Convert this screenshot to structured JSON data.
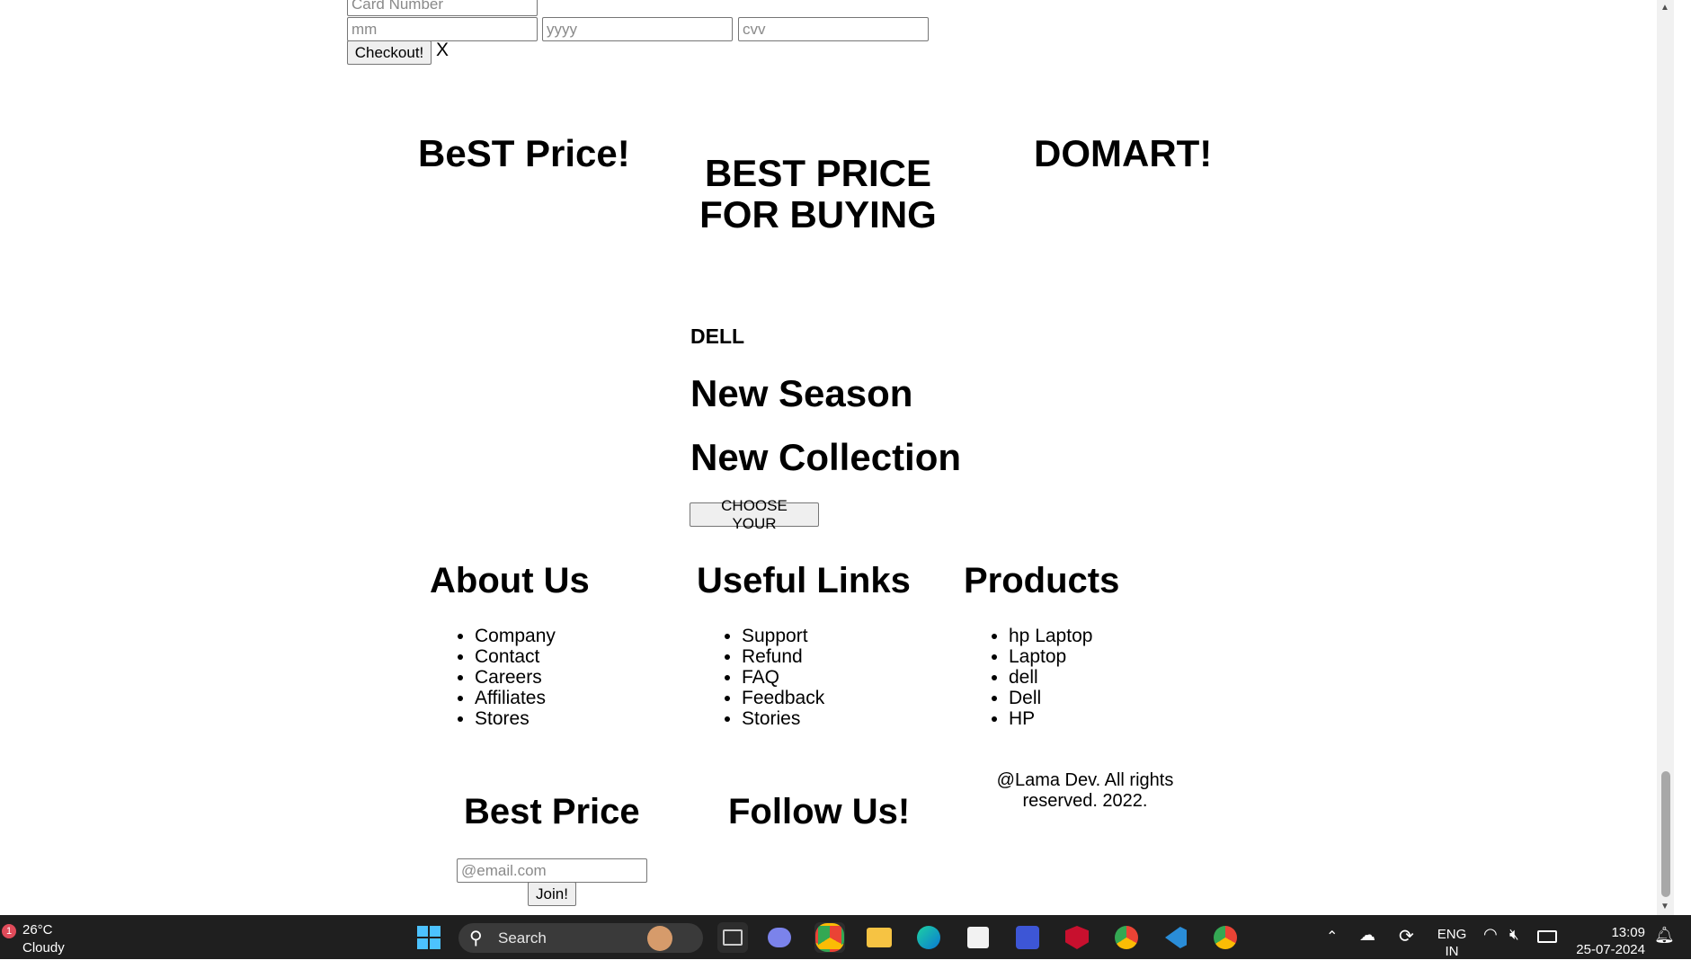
{
  "checkout": {
    "card_number_placeholder": "Card Number",
    "month_placeholder": "mm",
    "year_placeholder": "yyyy",
    "cvv_placeholder": "cvv",
    "checkout_label": "Checkout!",
    "close_label": "X"
  },
  "banner": {
    "left": "BeST Price!",
    "center_line1": "BEST PRICE",
    "center_line2": "FOR BUYING",
    "right": "DOMART!"
  },
  "hero": {
    "brand": "DELL",
    "line1": "New Season",
    "line2": "New Collection",
    "button": "CHOOSE YOUR"
  },
  "footer": {
    "about": {
      "title": "About Us",
      "items": [
        "Company",
        "Contact",
        "Careers",
        "Affiliates",
        "Stores"
      ]
    },
    "useful": {
      "title": "Useful Links",
      "items": [
        "Support",
        "Refund",
        "FAQ",
        "Feedback",
        "Stories"
      ]
    },
    "products": {
      "title": "Products",
      "items": [
        "hp Laptop",
        "Laptop",
        "dell",
        "Dell",
        "HP"
      ]
    },
    "copyright_line1": "@Lama Dev. All rights",
    "copyright_line2": "reserved. 2022.",
    "newsletter": {
      "title": "Best Price",
      "email_placeholder": "@email.com",
      "join_label": "Join!"
    },
    "follow_title": "Follow Us!"
  },
  "taskbar": {
    "weather_temp": "26°C",
    "weather_desc": "Cloudy",
    "weather_badge": "1",
    "search_label": "Search",
    "lang_top": "ENG",
    "lang_bottom": "IN",
    "time": "13:09",
    "date": "25-07-2024"
  }
}
